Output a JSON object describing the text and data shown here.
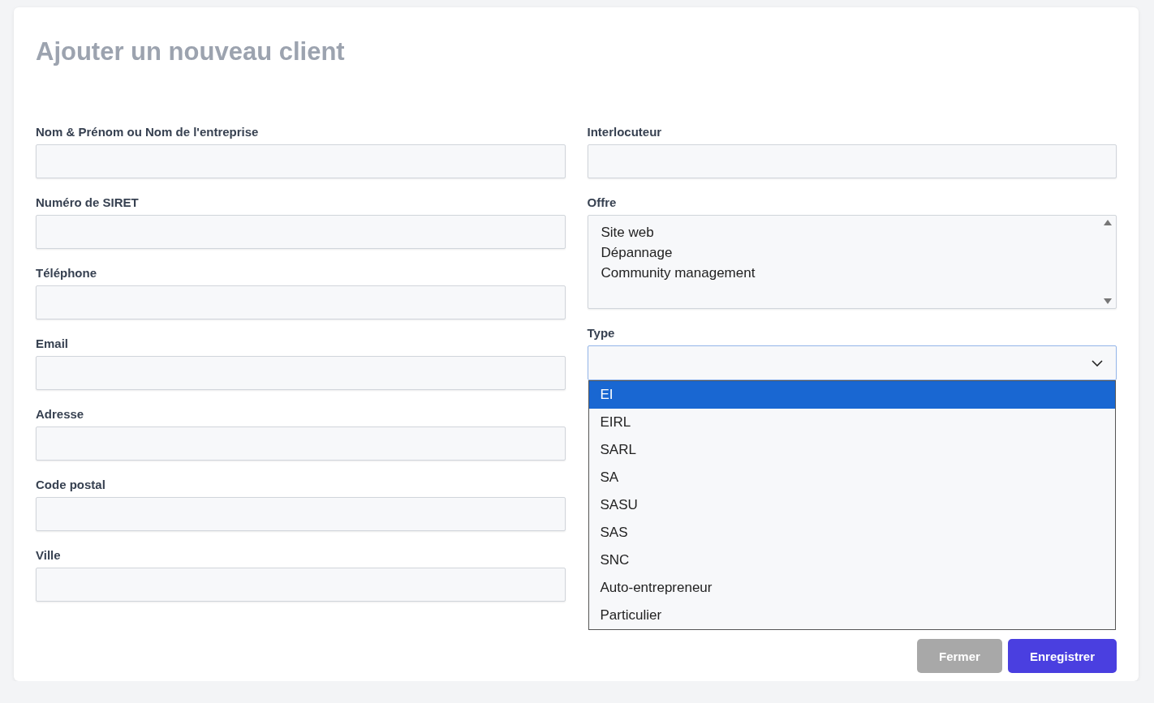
{
  "title": "Ajouter un nouveau client",
  "left_fields": [
    {
      "label": "Nom & Prénom ou Nom de l'entreprise"
    },
    {
      "label": "Numéro de SIRET"
    },
    {
      "label": "Téléphone"
    },
    {
      "label": "Email"
    },
    {
      "label": "Adresse"
    },
    {
      "label": "Code postal"
    },
    {
      "label": "Ville"
    }
  ],
  "interlocuteur": {
    "label": "Interlocuteur"
  },
  "offre": {
    "label": "Offre",
    "options": [
      "Site web",
      "Dépannage",
      "Community management"
    ]
  },
  "type": {
    "label": "Type",
    "expanded": true,
    "options": [
      {
        "label": "EI",
        "selected": true
      },
      {
        "label": "EIRL",
        "selected": false
      },
      {
        "label": "SARL",
        "selected": false
      },
      {
        "label": "SA",
        "selected": false
      },
      {
        "label": "SASU",
        "selected": false
      },
      {
        "label": "SAS",
        "selected": false
      },
      {
        "label": "SNC",
        "selected": false
      },
      {
        "label": "Auto-entrepreneur",
        "selected": false
      },
      {
        "label": "Particulier",
        "selected": false
      }
    ]
  },
  "buttons": [
    {
      "label": "Fermer",
      "kind": "secondary"
    },
    {
      "label": "Enregistrer",
      "kind": "primary"
    }
  ]
}
